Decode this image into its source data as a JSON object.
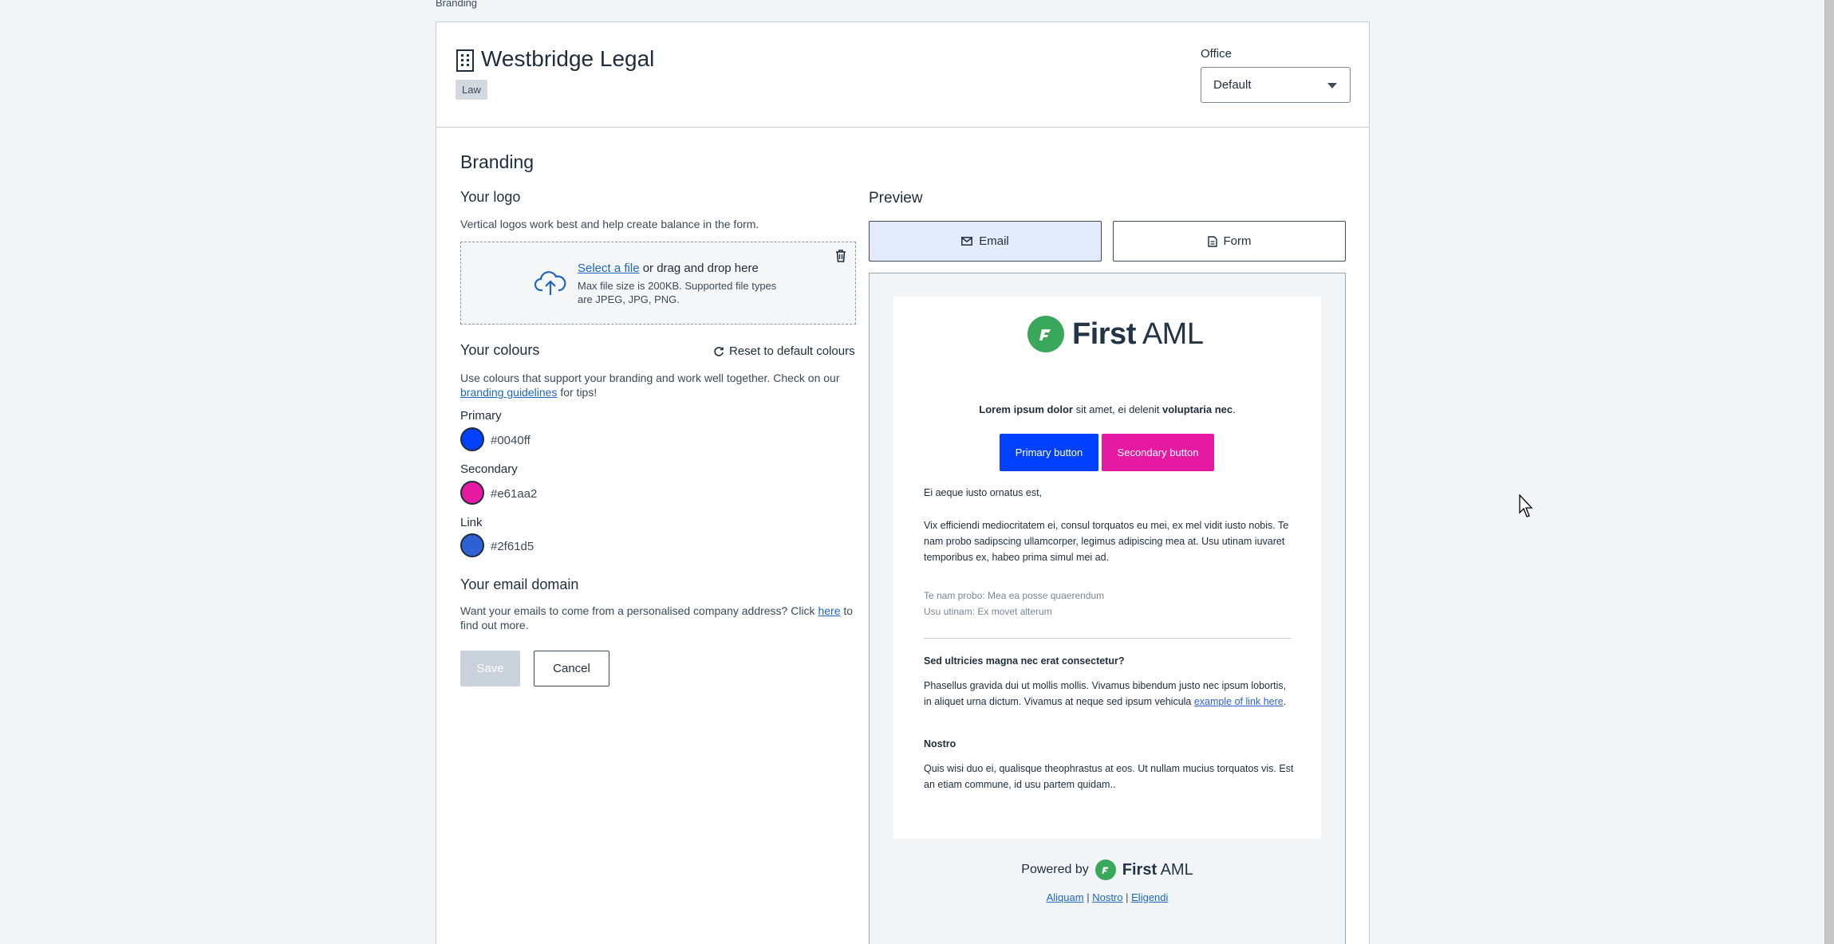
{
  "breadcrumb": "Branding",
  "company": {
    "name": "Westbridge Legal",
    "industry": "Law"
  },
  "office": {
    "label": "Office",
    "selected": "Default"
  },
  "section_title": "Branding",
  "logo": {
    "heading": "Your logo",
    "description": "Vertical logos work best and help create balance in the form.",
    "select_link": "Select a file",
    "drop_text": " or drag and drop here",
    "limits": "Max file size is 200KB. Supported file types are JPEG, JPG, PNG."
  },
  "colours": {
    "heading": "Your colours",
    "reset_label": "Reset to default colours",
    "description_before": "Use colours that support your branding and work well together. Check on our ",
    "guidelines_link": "branding guidelines",
    "description_after": " for tips!",
    "items": [
      {
        "label": "Primary",
        "hex": "#0040ff"
      },
      {
        "label": "Secondary",
        "hex": "#e61aa2"
      },
      {
        "label": "Link",
        "hex": "#2f61d5"
      }
    ]
  },
  "email_domain": {
    "heading": "Your email domain",
    "text_before": "Want your emails to come from a personalised company address? Click ",
    "link": "here",
    "text_after": " to find out more."
  },
  "actions": {
    "save": "Save",
    "cancel": "Cancel"
  },
  "preview": {
    "label": "Preview",
    "tabs": {
      "email": "Email",
      "form": "Form"
    },
    "logo_word_bold": "First",
    "logo_word_light": " AML",
    "intro_bold1": "Lorem ipsum dolor",
    "intro_mid": " sit amet, ei delenit ",
    "intro_bold2": "voluptaria nec",
    "intro_end": ".",
    "primary_button": "Primary button",
    "secondary_button": "Secondary button",
    "greeting": "Ei aeque iusto ornatus est,",
    "paragraph1": "Vix efficiendi mediocritatem ei, consul torquatos eu mei, ex mel vidit iusto nobis. Te nam probo sadipscing ullamcorper, legimus adipiscing mea at. Usu utinam iuvaret temporibus ex, habeo prima simul mei ad.",
    "meta1": "Te nam probo: Mea ea posse quaerendum",
    "meta2": "Usu utinam: Ex movet alterum",
    "question": "Sed ultricies magna nec erat consectetur?",
    "paragraph2_before": "Phasellus gravida dui ut mollis mollis. Vivamus bibendum justo nec ipsum lobortis, in aliquet urna dictum. Vivamus at neque sed ipsum vehicula ",
    "paragraph2_link": "example of link here",
    "paragraph2_after": ".",
    "subheading": "Nostro",
    "paragraph3": "Quis wisi duo ei, qualisque theophrastus at eos. Ut nullam mucius torquatos vis. Est an etiam commune, id usu partem quidam..",
    "powered_by": "Powered by",
    "footer_links": [
      "Aliquam",
      "Nostro",
      "Eligendi"
    ],
    "footer_sep": "|"
  }
}
